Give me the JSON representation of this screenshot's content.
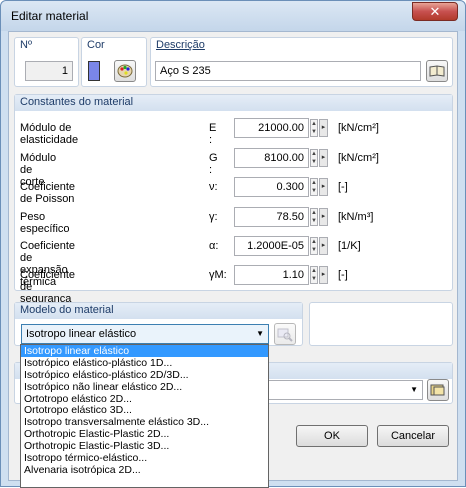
{
  "window": {
    "title": "Editar material",
    "close_glyph": "✕"
  },
  "header": {
    "no_label": "Nº",
    "no_value": "1",
    "color_label": "Cor",
    "color_swatch": "#7a86e8",
    "description_label": "Descrição",
    "description_value": "Aço S 235"
  },
  "constants": {
    "title": "Constantes do material",
    "rows": [
      {
        "label": "Módulo de elasticidade",
        "symbol": "E :",
        "value": "21000.00",
        "unit": "[kN/cm²]"
      },
      {
        "label": "Módulo de corte",
        "symbol": "G :",
        "value": "8100.00",
        "unit": "[kN/cm²]"
      },
      {
        "label": "Coeficiente de Poisson",
        "symbol": "ν:",
        "value": "0.300",
        "unit": "[-]"
      },
      {
        "label": "Peso específico",
        "symbol": "γ:",
        "value": "78.50",
        "unit": "[kN/m³]"
      },
      {
        "label": "Coeficiente de expansão térmica",
        "symbol": "α:",
        "value": "1.2000E-05",
        "unit": "[1/K]"
      },
      {
        "label": "Coeficiente de segurança parcial",
        "symbol": "γM:",
        "value": "1.10",
        "unit": "[-]"
      }
    ]
  },
  "model": {
    "title": "Modelo do material",
    "selected": "Isotropo linear elástico",
    "options": [
      "Isotropo linear elástico",
      "Isotrópico elástico-plástico 1D...",
      "Isotrópico elástico-plástico 2D/3D...",
      "Isotrópico não linear elástico 2D...",
      "Ortotropo elástico 2D...",
      "Ortotropo elástico 3D...",
      "Isotropo transversalmente elástico 3D...",
      "Orthotropic Elastic-Plastic 2D...",
      "Orthotropic Elastic-Plastic 3D...",
      "Isotropo térmico-elástico...",
      "Alvenaria isotrópica 2D..."
    ]
  },
  "buttons": {
    "ok": "OK",
    "cancel": "Cancelar"
  }
}
